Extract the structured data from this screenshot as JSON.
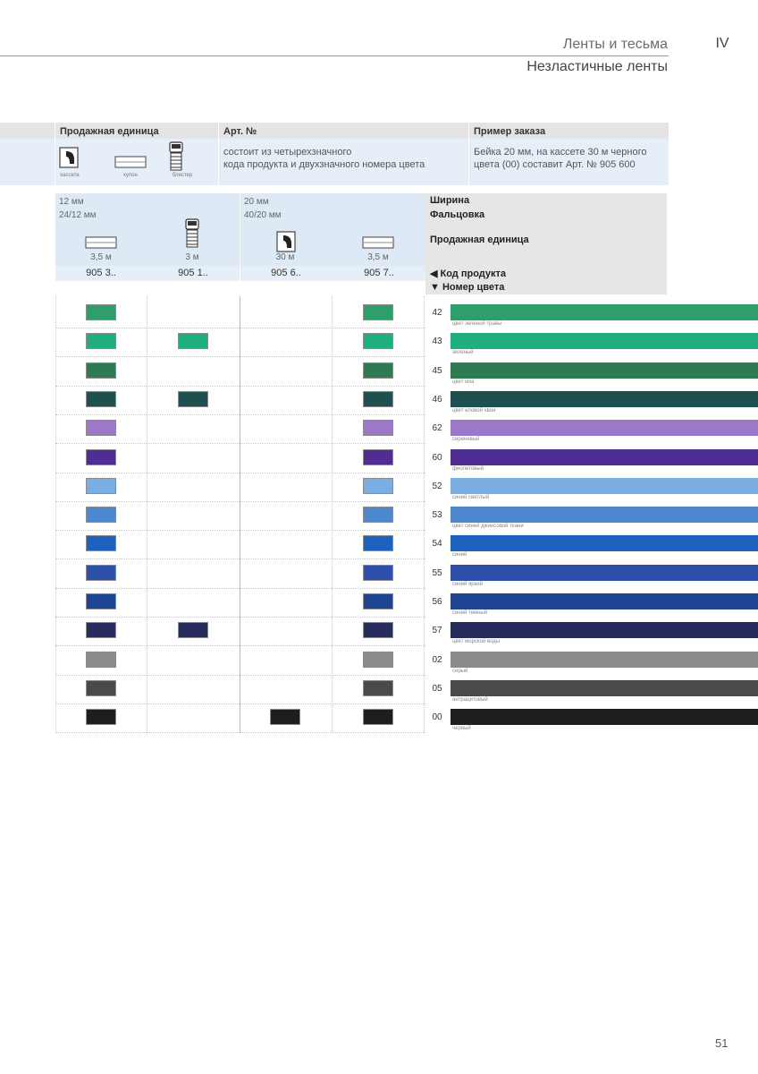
{
  "header": {
    "section": "Ленты и тесьма",
    "chapter": "IV",
    "subtitle": "Незластичные ленты"
  },
  "info": {
    "col1_title": "Продажная единица",
    "col2_title": "Арт. №",
    "col3_title": "Пример заказа",
    "icon_cassette": "кассета",
    "icon_coupon": "купон",
    "icon_blister": "блистер",
    "art_line1": "состоит из четырехзначного",
    "art_line2": "кода продукта и двухзначного номера цвета",
    "example_line1": "Бейка 20 мм, на кассете 30 м черного",
    "example_line2": "цвета (00) составит Арт. № 905 600"
  },
  "spec": {
    "width_a": "12 мм",
    "fold_a": "24/12 мм",
    "width_b": "20 мм",
    "fold_b": "40/20 мм",
    "len1": "3,5 м",
    "len2": "3 м",
    "len3": "30 м",
    "len4": "3,5 м",
    "code1": "905 3..",
    "code2": "905 1..",
    "code3": "905 6..",
    "code4": "905 7..",
    "label_width": "Ширина",
    "label_fold": "Фальцовка",
    "label_unit": "Продажная единица",
    "label_code": "◀ Код продукта",
    "label_color": "▼ Номер цвета"
  },
  "colors": [
    {
      "num": "42",
      "name": "цвет зеленой травы",
      "hex": "#2e9e6a",
      "avail": [
        1,
        0,
        0,
        1
      ]
    },
    {
      "num": "43",
      "name": "зеленый",
      "hex": "#1fae7c",
      "avail": [
        1,
        1,
        0,
        1
      ]
    },
    {
      "num": "45",
      "name": "цвет мха",
      "hex": "#2e7a52",
      "avail": [
        1,
        0,
        0,
        1
      ]
    },
    {
      "num": "46",
      "name": "цвет еловой хвои",
      "hex": "#1f5050",
      "avail": [
        1,
        1,
        0,
        1
      ]
    },
    {
      "num": "62",
      "name": "сиреневый",
      "hex": "#9b78c8",
      "avail": [
        1,
        0,
        0,
        1
      ]
    },
    {
      "num": "60",
      "name": "фиолетовый",
      "hex": "#4e2e94",
      "avail": [
        1,
        0,
        0,
        1
      ]
    },
    {
      "num": "52",
      "name": "синий светлый",
      "hex": "#7aaee0",
      "avail": [
        1,
        0,
        0,
        1
      ]
    },
    {
      "num": "53",
      "name": "цвет синей джинсовой ткани",
      "hex": "#4f86d0",
      "avail": [
        1,
        0,
        0,
        1
      ]
    },
    {
      "num": "54",
      "name": "синий",
      "hex": "#1d62bf",
      "avail": [
        1,
        0,
        0,
        1
      ]
    },
    {
      "num": "55",
      "name": "синий яркий",
      "hex": "#2e4fa8",
      "avail": [
        1,
        0,
        0,
        1
      ]
    },
    {
      "num": "56",
      "name": "синий темный",
      "hex": "#1f4491",
      "avail": [
        1,
        0,
        0,
        1
      ]
    },
    {
      "num": "57",
      "name": "цвет морской воды",
      "hex": "#272c5c",
      "avail": [
        1,
        1,
        0,
        1
      ]
    },
    {
      "num": "02",
      "name": "серый",
      "hex": "#8a8a8c",
      "avail": [
        1,
        0,
        0,
        1
      ]
    },
    {
      "num": "05",
      "name": "антрацитовый",
      "hex": "#4a4a4c",
      "avail": [
        1,
        0,
        0,
        1
      ]
    },
    {
      "num": "00",
      "name": "черный",
      "hex": "#1e1e1e",
      "avail": [
        1,
        0,
        1,
        1
      ]
    }
  ],
  "page_number": "51"
}
